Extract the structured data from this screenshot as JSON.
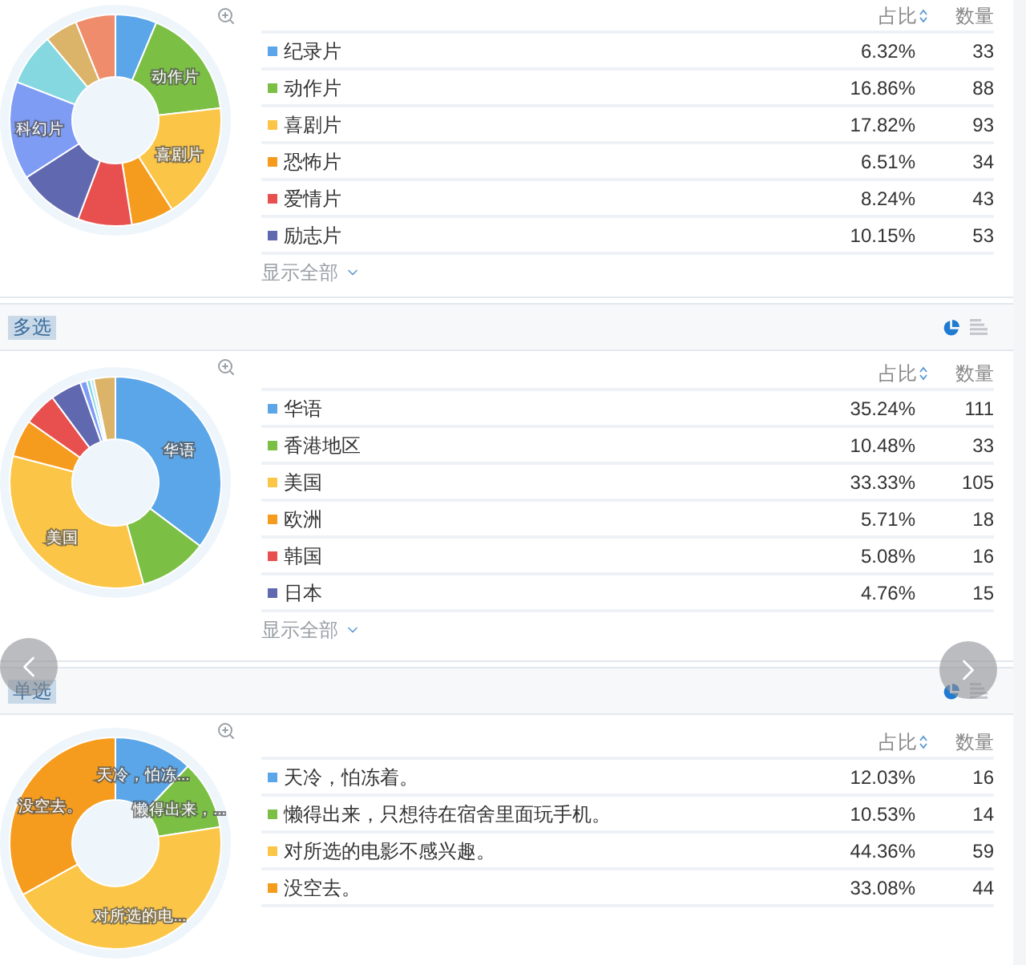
{
  "sections": [
    {
      "columns": {
        "percent": "占比",
        "count": "数量"
      },
      "rows": [
        {
          "label": "纪录片",
          "color": "#5aa6e8",
          "percent": "6.32%",
          "count": "33"
        },
        {
          "label": "动作片",
          "color": "#7cbf45",
          "percent": "16.86%",
          "count": "88"
        },
        {
          "label": "喜剧片",
          "color": "#fbc547",
          "percent": "17.82%",
          "count": "93"
        },
        {
          "label": "恐怖片",
          "color": "#f59c1f",
          "percent": "6.51%",
          "count": "34"
        },
        {
          "label": "爱情片",
          "color": "#e8504f",
          "percent": "8.24%",
          "count": "43"
        },
        {
          "label": "励志片",
          "color": "#6068b0",
          "percent": "10.15%",
          "count": "53"
        }
      ],
      "show_all": "显示全部",
      "chart_data": {
        "type": "donut",
        "values": [
          6.32,
          16.86,
          17.82,
          6.51,
          8.24,
          10.15,
          15,
          8,
          5,
          6.1
        ],
        "colors": [
          "#5aa6e8",
          "#7cbf45",
          "#fbc547",
          "#f59c1f",
          "#e8504f",
          "#6068b0",
          "#7f9cf5",
          "#86d8e0",
          "#dbb46a",
          "#ef8c6c"
        ],
        "value_labels": [
          null,
          "动作片",
          "喜剧片",
          null,
          null,
          null,
          "科幻片",
          null,
          null,
          null
        ]
      }
    },
    {
      "tag": "多选",
      "view_buttons": [
        {
          "kind": "pie",
          "selected": true
        },
        {
          "kind": "list",
          "selected": false
        }
      ],
      "columns": {
        "percent": "占比",
        "count": "数量"
      },
      "rows": [
        {
          "label": "华语",
          "color": "#5aa6e8",
          "percent": "35.24%",
          "count": "111"
        },
        {
          "label": "香港地区",
          "color": "#7cbf45",
          "percent": "10.48%",
          "count": "33"
        },
        {
          "label": "美国",
          "color": "#fbc547",
          "percent": "33.33%",
          "count": "105"
        },
        {
          "label": "欧洲",
          "color": "#f59c1f",
          "percent": "5.71%",
          "count": "18"
        },
        {
          "label": "韩国",
          "color": "#e8504f",
          "percent": "5.08%",
          "count": "16"
        },
        {
          "label": "日本",
          "color": "#6068b0",
          "percent": "4.76%",
          "count": "15"
        }
      ],
      "show_all": "显示全部",
      "chart_data": {
        "type": "donut",
        "values": [
          35.24,
          10.48,
          33.33,
          5.71,
          5.08,
          4.76,
          1,
          0.6,
          0.5,
          3.3
        ],
        "colors": [
          "#5aa6e8",
          "#7cbf45",
          "#fbc547",
          "#f59c1f",
          "#e8504f",
          "#6068b0",
          "#7f9cf5",
          "#86d8e0",
          "#bfe3f0",
          "#dbb46a"
        ],
        "value_labels": [
          "华语",
          null,
          "美国",
          null,
          null,
          null,
          null,
          null,
          null,
          null
        ]
      }
    },
    {
      "tag": "单选",
      "view_buttons": [
        {
          "kind": "pie",
          "selected": true
        },
        {
          "kind": "list",
          "selected": false
        }
      ],
      "columns": {
        "percent": "占比",
        "count": "数量"
      },
      "rows": [
        {
          "label": "天冷，怕冻着。",
          "color": "#5aa6e8",
          "percent": "12.03%",
          "count": "16"
        },
        {
          "label": "懒得出来，只想待在宿舍里面玩手机。",
          "color": "#7cbf45",
          "percent": "10.53%",
          "count": "14"
        },
        {
          "label": "对所选的电影不感兴趣。",
          "color": "#fbc547",
          "percent": "44.36%",
          "count": "59"
        },
        {
          "label": "没空去。",
          "color": "#f59c1f",
          "percent": "33.08%",
          "count": "44"
        }
      ],
      "chart_data": {
        "type": "donut",
        "values": [
          12.03,
          10.53,
          44.36,
          33.08
        ],
        "colors": [
          "#5aa6e8",
          "#7cbf45",
          "#fbc547",
          "#f59c1f"
        ],
        "value_labels": [
          "天冷，怕冻...",
          "懒得出来，...",
          "对所选的电...",
          "没空去。"
        ]
      }
    }
  ]
}
